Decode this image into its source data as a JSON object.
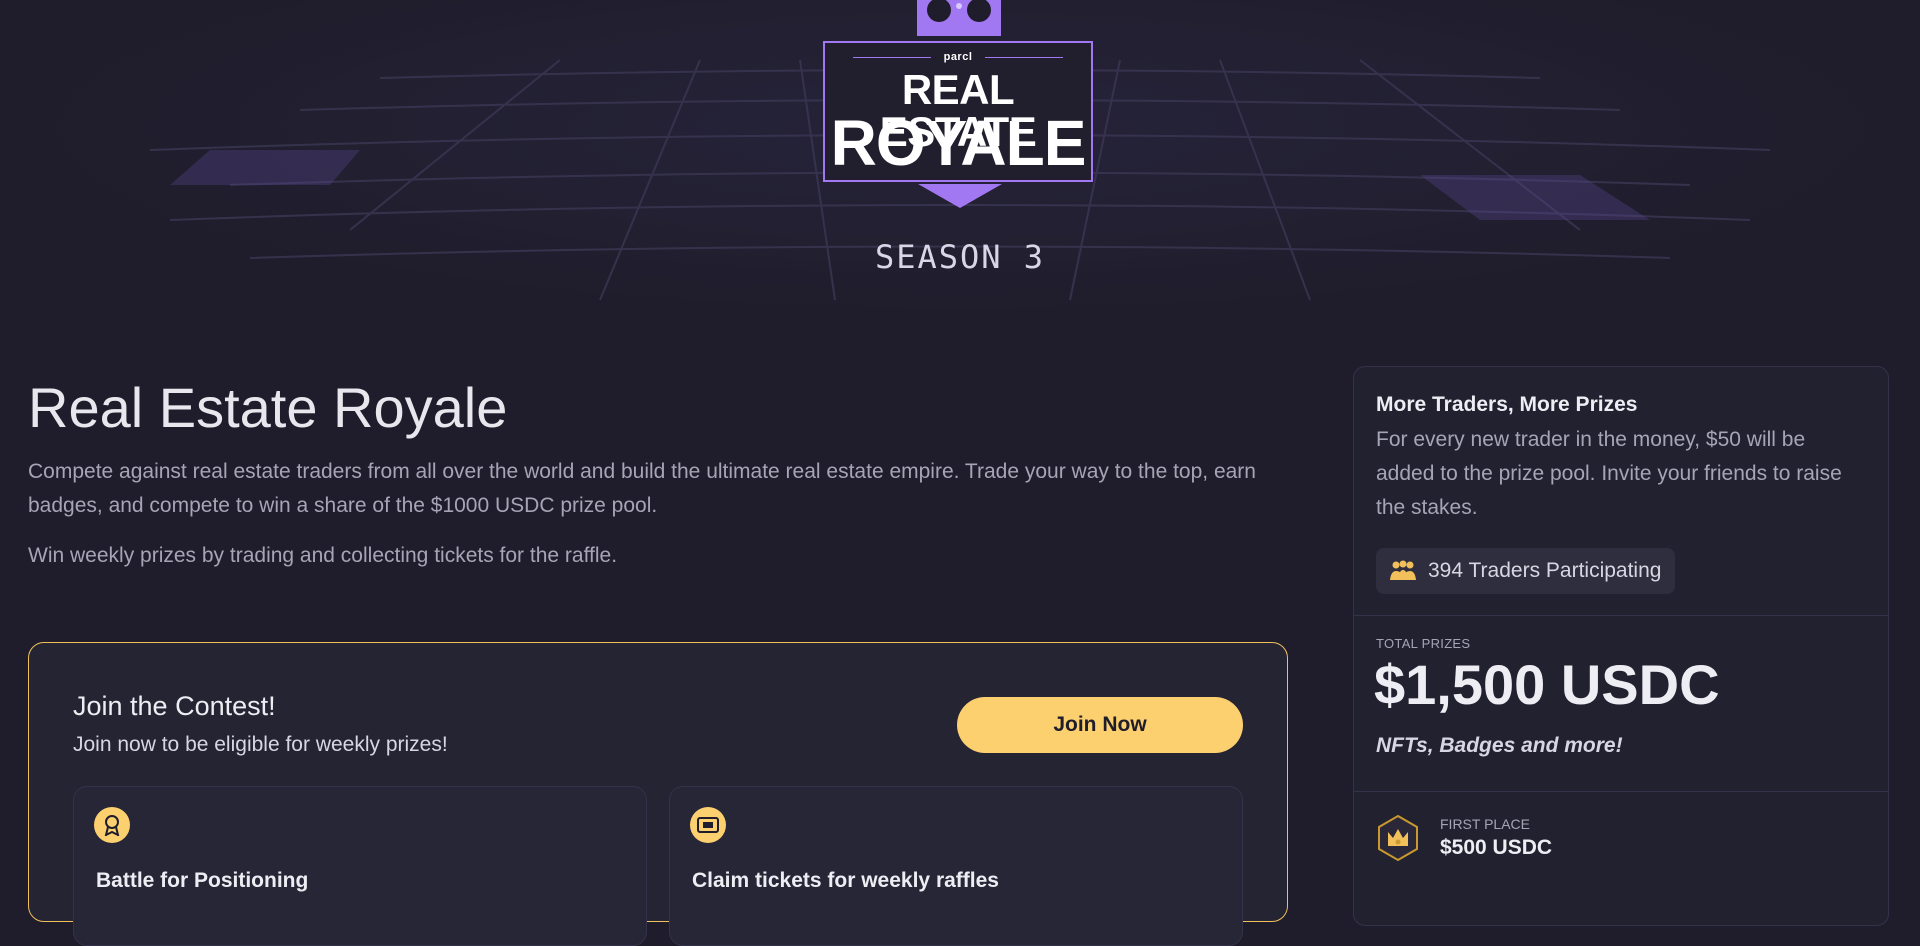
{
  "hero": {
    "logo_brand": "parcl",
    "logo_line1": "REAL ESTATE",
    "logo_line2": "ROYALE",
    "season": "SEASON 3"
  },
  "main": {
    "title": "Real Estate Royale",
    "description": "Compete against real estate traders from all over the world and build the ultimate real estate empire. Trade your way to the top, earn badges, and compete to win a share of the $1000 USDC prize pool.",
    "weekly_text": "Win weekly prizes by trading and collecting tickets for the raffle."
  },
  "contest": {
    "title": "Join the Contest!",
    "subtitle": "Join now to be eligible for weekly prizes!",
    "join_label": "Join Now",
    "features": [
      {
        "icon": "award-icon",
        "title": "Battle for Positioning"
      },
      {
        "icon": "ticket-icon",
        "title": "Claim tickets for weekly raffles"
      }
    ]
  },
  "side": {
    "heading": "More Traders, More Prizes",
    "text": "For every new trader in the money, $50 will be added to the prize pool. Invite your friends to raise the stakes.",
    "traders_badge": "394 Traders Participating",
    "total_prizes_label": "TOTAL PRIZES",
    "total_prizes_value": "$1,500 USDC",
    "total_prizes_sub": "NFTs, Badges and more!",
    "first_place_label": "FIRST PLACE",
    "first_place_value": "$500 USDC"
  },
  "colors": {
    "background": "#1f1d2b",
    "accent_purple": "#a178f2",
    "accent_yellow": "#fdd06f"
  }
}
